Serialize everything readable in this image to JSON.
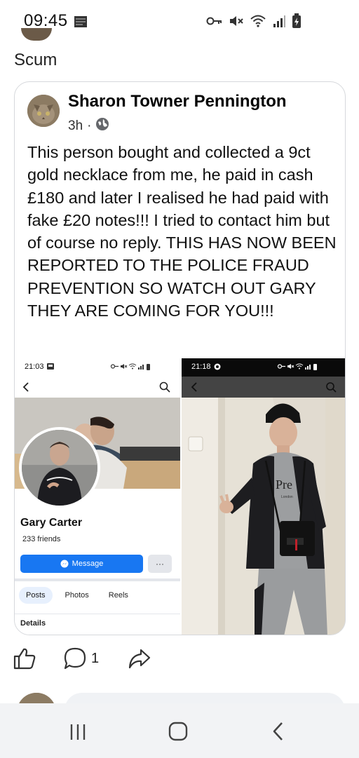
{
  "status_bar": {
    "time": "09:45",
    "icons": [
      "notification-icon",
      "vpn-key-icon",
      "mute-icon",
      "wifi-icon",
      "signal-icon",
      "battery-charging-icon"
    ]
  },
  "group_label": "Scum",
  "post": {
    "author": "Sharon Towner Pennington",
    "time": "3h",
    "separator": "·",
    "privacy_icon": "globe-icon",
    "text": "This person bought and collected a 9ct gold necklace from me, he paid in cash £180 and later I realised he had paid with fake £20 notes!!! I tried to contact him but of course no reply. THIS HAS NOW BEEN REPORTED TO THE POLICE FRAUD PREVENTION SO WATCH OUT GARY THEY ARE COMING FOR YOU!!!"
  },
  "left_screenshot": {
    "time": "21:03",
    "profile_name": "Gary Carter",
    "friends": "233 friends",
    "message_label": "Message",
    "more_label": "···",
    "tabs": [
      "Posts",
      "Photos",
      "Reels"
    ],
    "active_tab": "Posts",
    "details_label": "Details"
  },
  "right_screenshot": {
    "time": "21:18",
    "hoodie_text": "Pre",
    "hoodie_subtext": "London"
  },
  "actions": {
    "comment_count": "1"
  },
  "colors": {
    "accent": "#1877f2",
    "card_border": "#d6d8dc",
    "nav_bar": "#f2f3f5"
  }
}
